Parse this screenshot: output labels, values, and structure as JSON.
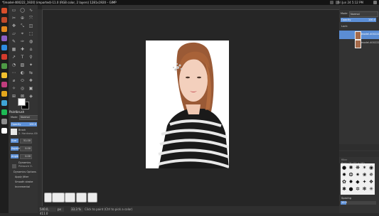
{
  "window": {
    "title": "*[model-400222_1920] (imported)-11.0 (RGB color, 2 layers) 1281x1920 – GIMP",
    "clock": "Fri Jun 24 5:12 PM"
  },
  "launcher": {
    "apps": [
      "dash-icon",
      "files-icon",
      "firefox-icon",
      "software-icon",
      "settings-icon",
      "terminal-icon",
      "gimp-icon",
      "text-editor-icon",
      "store-icon",
      "chrome-icon",
      "chat-icon",
      "photos-icon",
      "spotify-icon",
      "trash-icon"
    ],
    "colors": [
      "#d94f2b",
      "#c14a2a",
      "#e48a1f",
      "#8c5fc4",
      "#2e8ce0",
      "#d33b2d",
      "#4d9a45",
      "#f2c02e",
      "#c13d7d",
      "#e4a61c",
      "#3fa4d6",
      "#1db954",
      "#8e8e8e",
      "#ffffff"
    ]
  },
  "tool_options": {
    "title": "Paintbrush",
    "mode_label": "Mode",
    "mode_value": "Normal",
    "opacity_label": "Opacity",
    "opacity_value": "100.0",
    "brush_label": "Brush",
    "brush_name": "2. Hardness 050",
    "size_label": "Size",
    "size_value": "51.00",
    "aspect_label": "Aspect",
    "aspect_value": "0.00",
    "angle_label": "Angle",
    "angle_value": "0.00",
    "dynamics_label": "Dynamics",
    "dynamics_value": "Pressure O.",
    "dynamics_options": "Dynamics Options",
    "apply_jitter": "Apply Jitter",
    "smooth_stroke": "Smooth stroke",
    "incremental": "Incremental"
  },
  "status": {
    "coords": "540.0, 411.0",
    "unit": "px",
    "zoom": "33.3 %",
    "message": "Click to paint (Ctrl to pick a color)"
  },
  "layers": {
    "mode_label": "Mode",
    "mode_value": "Normal",
    "opacity_label": "Opacity",
    "opacity_value": "100.0",
    "lock_label": "Lock:",
    "items": [
      {
        "name": "model-400222_1",
        "selected": true
      },
      {
        "name": "model-400222_1",
        "selected": false
      }
    ]
  },
  "brushes": {
    "filter_label": "filter",
    "current": "Basic,01 (11 × 10)",
    "spacing_label": "Spacing",
    "spacing_value": "10.0"
  }
}
